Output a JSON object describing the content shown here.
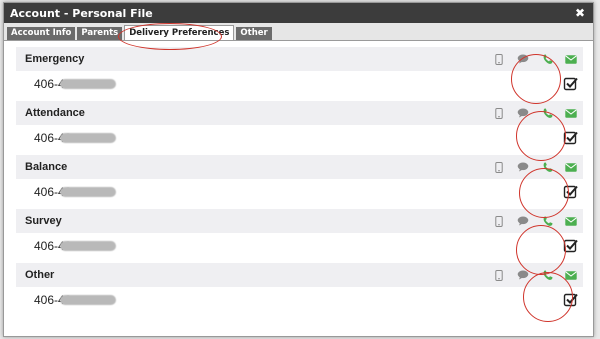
{
  "window": {
    "title": "Account - Personal File",
    "close_label": "✖"
  },
  "tabs": [
    {
      "label": "Account Info",
      "active": false
    },
    {
      "label": "Parents",
      "active": false
    },
    {
      "label": "Delivery Preferences",
      "active": true
    },
    {
      "label": "Other",
      "active": false
    }
  ],
  "groups": [
    {
      "title": "Emergency",
      "phone_prefix": "406-4",
      "sms_active": false,
      "voice_active": true,
      "email_active": true,
      "checked": true
    },
    {
      "title": "Attendance",
      "phone_prefix": "406-49",
      "sms_active": false,
      "voice_active": true,
      "email_active": true,
      "checked": true
    },
    {
      "title": "Balance",
      "phone_prefix": "406-49",
      "sms_active": false,
      "voice_active": true,
      "email_active": true,
      "checked": true
    },
    {
      "title": "Survey",
      "phone_prefix": "406-49",
      "sms_active": false,
      "voice_active": true,
      "email_active": true,
      "checked": true
    },
    {
      "title": "Other",
      "phone_prefix": "406-49",
      "sms_active": false,
      "voice_active": true,
      "email_active": true,
      "checked": true
    }
  ],
  "icons": {
    "mobile": "mobile-phone-icon",
    "sms": "chat-bubble-icon",
    "voice": "phone-handset-icon",
    "email": "envelope-icon",
    "checkbox": "checkbox-checked-icon"
  },
  "colors": {
    "titlebar": "#3c3c3c",
    "active_green": "#4caf50",
    "icon_gray": "#8a8a8a",
    "annotation_red": "#d0352c"
  }
}
